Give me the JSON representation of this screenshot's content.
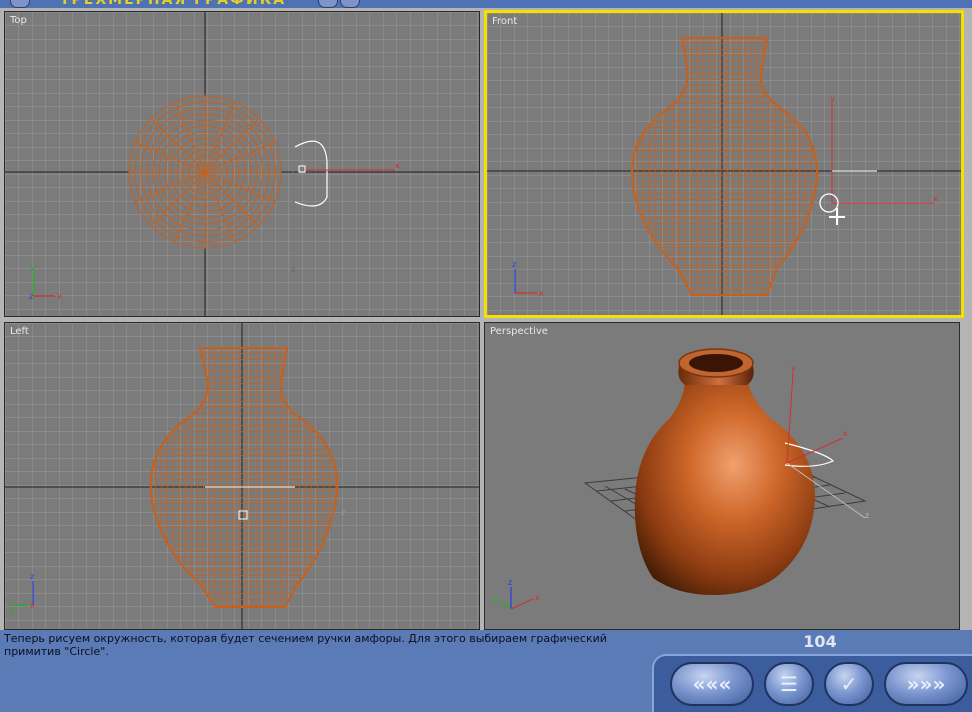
{
  "app": {
    "title": "ТРЁХМЕРНАЯ ГРАФИКА"
  },
  "viewports": {
    "top": {
      "label": "Top"
    },
    "front": {
      "label": "Front",
      "active": true
    },
    "left": {
      "label": "Left"
    },
    "perspective": {
      "label": "Perspective"
    }
  },
  "axes": {
    "x": "x",
    "y": "y",
    "z": "z"
  },
  "footer": {
    "caption": "Теперь рисуем окружность, которая будет сечением ручки амфоры. Для этого выбираем графический\nпримитив \"Circle\".",
    "page_number": "104"
  },
  "nav": {
    "back_icon": "«««",
    "contents_icon": "☰",
    "check_icon": "✓",
    "forward_icon": "»»»"
  },
  "colors": {
    "wireframe": "#c8601a",
    "grid": "#9a9a9a",
    "viewport_bg": "#7b7b7b",
    "active_border": "#f5e000",
    "ui_blue": "#5a7bb5",
    "page_number": "#dfe6f5"
  }
}
